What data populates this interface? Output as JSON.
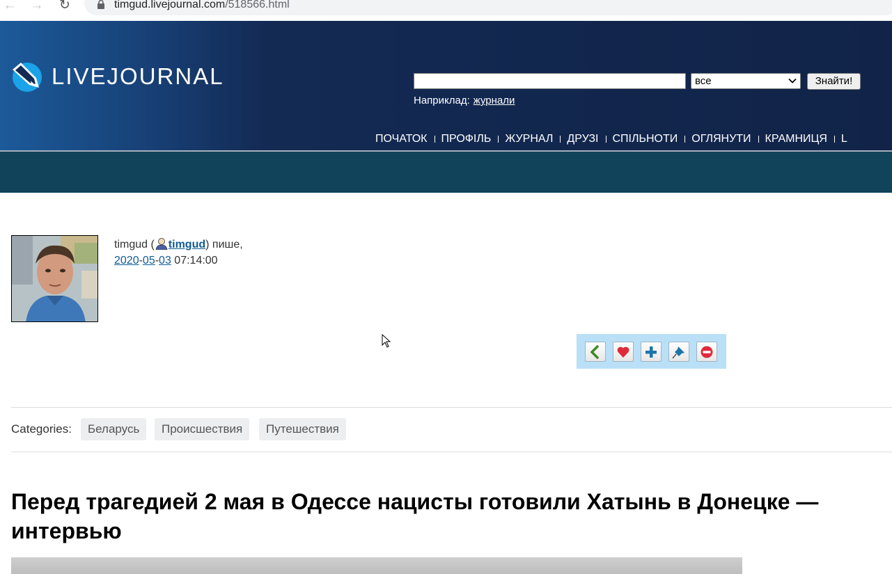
{
  "browser": {
    "url_host": "timgud.livejournal.com",
    "url_path": "/518566.html"
  },
  "header": {
    "logo_text": "LIVEJOURNAL",
    "search": {
      "value": "",
      "select_value": "все",
      "button_label": "Знайти!"
    },
    "example_label": "Наприклад:",
    "example_link": "журнали",
    "nav": [
      "ПОЧАТОК",
      "ПРОФІЛЬ",
      "ЖУРНАЛ",
      "ДРУЗІ",
      "СПІЛЬНОТИ",
      "ОГЛЯНУТИ",
      "КРАМНИЦЯ",
      "L"
    ]
  },
  "post": {
    "author_display": "timgud (",
    "author_link": "timgud",
    "author_suffix": ") пише,",
    "date_year": "2020",
    "date_month": "05",
    "date_day": "03",
    "time": "07:14:00",
    "categories_label": "Categories:",
    "categories": [
      "Беларусь",
      "Происшествия",
      "Путешествия"
    ],
    "title": "Перед трагедией 2 мая в Одессе нацисты готовили Хатынь в Донецке — интервью"
  },
  "toolbar": {
    "icons": [
      "arrow-left-icon",
      "heart-icon",
      "plus-icon",
      "pin-icon",
      "minus-circle-icon"
    ]
  },
  "colors": {
    "header_dark": "#112348",
    "band": "#11435a",
    "toolbar_bg": "#b9e0f7",
    "link": "#0f5b95",
    "logo_accent": "#1aa3e8"
  }
}
